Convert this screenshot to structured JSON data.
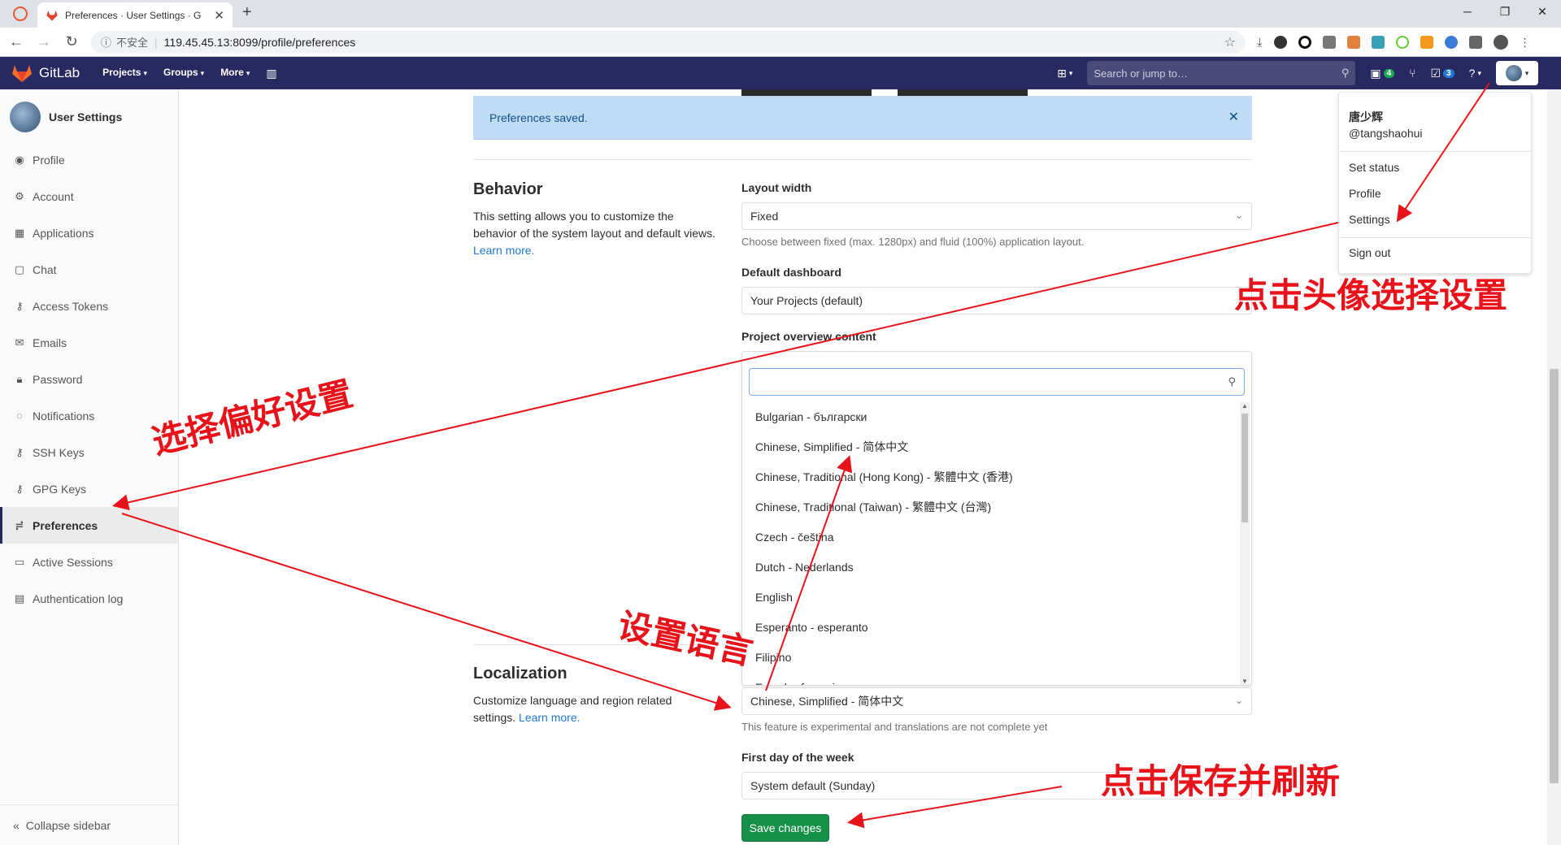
{
  "browser": {
    "tab_title": "Preferences · User Settings · G",
    "security_label": "不安全",
    "url": "119.45.45.13:8099/profile/preferences"
  },
  "header": {
    "brand": "GitLab",
    "nav": [
      "Projects",
      "Groups",
      "More"
    ],
    "search_placeholder": "Search or jump to…",
    "issues_count": "4",
    "todos_count": "3"
  },
  "sidebar": {
    "title": "User Settings",
    "items": [
      {
        "label": "Profile",
        "icon": "profile-icon"
      },
      {
        "label": "Account",
        "icon": "account-icon"
      },
      {
        "label": "Applications",
        "icon": "applications-icon"
      },
      {
        "label": "Chat",
        "icon": "chat-icon"
      },
      {
        "label": "Access Tokens",
        "icon": "key-icon"
      },
      {
        "label": "Emails",
        "icon": "mail-icon"
      },
      {
        "label": "Password",
        "icon": "lock-icon"
      },
      {
        "label": "Notifications",
        "icon": "bell-icon"
      },
      {
        "label": "SSH Keys",
        "icon": "key-icon"
      },
      {
        "label": "GPG Keys",
        "icon": "key-icon"
      },
      {
        "label": "Preferences",
        "icon": "preferences-icon"
      },
      {
        "label": "Active Sessions",
        "icon": "monitor-icon"
      },
      {
        "label": "Authentication log",
        "icon": "log-icon"
      }
    ],
    "collapse_label": "Collapse sidebar"
  },
  "flash": {
    "message": "Preferences saved."
  },
  "behavior": {
    "title": "Behavior",
    "description": "This setting allows you to customize the behavior of the system layout and default views.",
    "learn_more": "Learn more.",
    "layout_width_label": "Layout width",
    "layout_width_value": "Fixed",
    "layout_width_help": "Choose between fixed (max. 1280px) and fluid (100%) application layout.",
    "default_dashboard_label": "Default dashboard",
    "default_dashboard_value": "Your Projects (default)",
    "project_overview_label": "Project overview content"
  },
  "language_dropdown": {
    "options": [
      "Bulgarian - български",
      "Chinese, Simplified - 简体中文",
      "Chinese, Traditional (Hong Kong) - 繁體中文 (香港)",
      "Chinese, Traditional (Taiwan) - 繁體中文 (台灣)",
      "Czech - čeština",
      "Dutch - Nederlands",
      "English",
      "Esperanto - esperanto",
      "Filipino",
      "French - français"
    ]
  },
  "localization": {
    "title": "Localization",
    "description": "Customize language and region related settings.",
    "learn_more": "Learn more.",
    "language_value": "Chinese, Simplified - 简体中文",
    "language_help": "This feature is experimental and translations are not complete yet",
    "first_day_label": "First day of the week",
    "first_day_value": "System default (Sunday)"
  },
  "save_button": "Save changes",
  "user_menu": {
    "name": "唐少辉",
    "username": "@tangshaohui",
    "items": [
      "Set status",
      "Profile",
      "Settings",
      "Sign out"
    ]
  },
  "annotations": {
    "click_avatar": "点击头像选择设置",
    "select_preferences": "选择偏好设置",
    "set_language": "设置语言",
    "save_refresh": "点击保存并刷新"
  },
  "colors": {
    "header": "#292961",
    "save": "#168f48",
    "annotation": "#e8121a",
    "flash": "#c0dcf5"
  }
}
